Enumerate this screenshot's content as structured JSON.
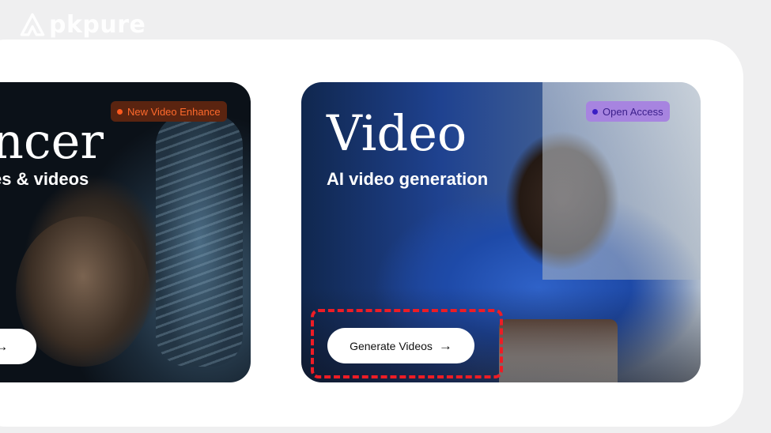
{
  "watermark": {
    "text": "pkpure"
  },
  "cards": [
    {
      "title": "ncer",
      "subtitle": "es & videos",
      "badge": {
        "label": "New Video Enhance",
        "bg": "#5a2410",
        "text_color": "#ff6a2c",
        "dot": "#ff5a1f"
      },
      "button": {
        "label": "",
        "icon": "arrow-right-icon"
      }
    },
    {
      "title": "Video",
      "subtitle": "AI video generation",
      "badge": {
        "label": "Open Access",
        "bg": "#a784e0",
        "text_color": "#3a1e8a",
        "dot": "#3b1fc4"
      },
      "button": {
        "label": "Generate Videos",
        "icon": "arrow-right-icon"
      }
    }
  ],
  "annotation": {
    "color": "#ee1c25",
    "target": "generate-videos-button"
  }
}
